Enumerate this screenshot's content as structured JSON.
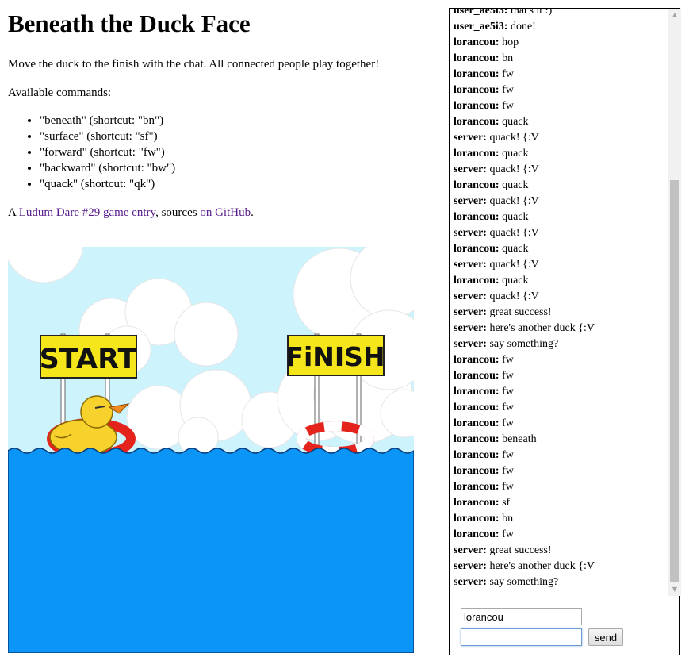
{
  "page": {
    "title": "Beneath the Duck Face",
    "intro": "Move the duck to the finish with the chat. All connected people play together!",
    "available": "Available commands:",
    "commands": [
      "\"beneath\" (shortcut: \"bn\")",
      "\"surface\" (shortcut: \"sf\")",
      "\"forward\" (shortcut: \"fw\")",
      "\"backward\" (shortcut: \"bw\")",
      "\"quack\" (shortcut: \"qk\")"
    ],
    "credits": {
      "prefix": "A ",
      "link1": "Ludum Dare #29 game entry",
      "middle": ", sources ",
      "link2": "on GitHub",
      "suffix": "."
    }
  },
  "game": {
    "start_sign": "START",
    "finish_sign": "FiNISH",
    "colors": {
      "sky": "#cdf3fd",
      "water": "#0b95f6",
      "sign": "#f5e61c",
      "duck": "#f7d12c",
      "ring": "#e5231d"
    }
  },
  "chat": {
    "messages": [
      {
        "user": "user_ae5i3:",
        "text": "that's it :)"
      },
      {
        "user": "user_ae5i3:",
        "text": "done!"
      },
      {
        "user": "lorancou:",
        "text": "hop"
      },
      {
        "user": "lorancou:",
        "text": "bn"
      },
      {
        "user": "lorancou:",
        "text": "fw"
      },
      {
        "user": "lorancou:",
        "text": "fw"
      },
      {
        "user": "lorancou:",
        "text": "fw"
      },
      {
        "user": "lorancou:",
        "text": "quack"
      },
      {
        "user": "server:",
        "text": "quack! {:V"
      },
      {
        "user": "lorancou:",
        "text": "quack"
      },
      {
        "user": "server:",
        "text": "quack! {:V"
      },
      {
        "user": "lorancou:",
        "text": "quack"
      },
      {
        "user": "server:",
        "text": "quack! {:V"
      },
      {
        "user": "lorancou:",
        "text": "quack"
      },
      {
        "user": "server:",
        "text": "quack! {:V"
      },
      {
        "user": "lorancou:",
        "text": "quack"
      },
      {
        "user": "server:",
        "text": "quack! {:V"
      },
      {
        "user": "lorancou:",
        "text": "quack"
      },
      {
        "user": "server:",
        "text": "quack! {:V"
      },
      {
        "user": "server:",
        "text": "great success!"
      },
      {
        "user": "server:",
        "text": "here's another duck {:V"
      },
      {
        "user": "server:",
        "text": "say something?"
      },
      {
        "user": "lorancou:",
        "text": "fw"
      },
      {
        "user": "lorancou:",
        "text": "fw"
      },
      {
        "user": "lorancou:",
        "text": "fw"
      },
      {
        "user": "lorancou:",
        "text": "fw"
      },
      {
        "user": "lorancou:",
        "text": "fw"
      },
      {
        "user": "lorancou:",
        "text": "beneath"
      },
      {
        "user": "lorancou:",
        "text": "fw"
      },
      {
        "user": "lorancou:",
        "text": "fw"
      },
      {
        "user": "lorancou:",
        "text": "fw"
      },
      {
        "user": "lorancou:",
        "text": "sf"
      },
      {
        "user": "lorancou:",
        "text": "bn"
      },
      {
        "user": "lorancou:",
        "text": "fw"
      },
      {
        "user": "server:",
        "text": "great success!"
      },
      {
        "user": "server:",
        "text": "here's another duck {:V"
      },
      {
        "user": "server:",
        "text": "say something?"
      }
    ],
    "name_value": "lorancou",
    "message_value": "",
    "send_label": "send",
    "scroll_up_icon": "triangle-up-icon",
    "scroll_down_icon": "triangle-down-icon"
  }
}
